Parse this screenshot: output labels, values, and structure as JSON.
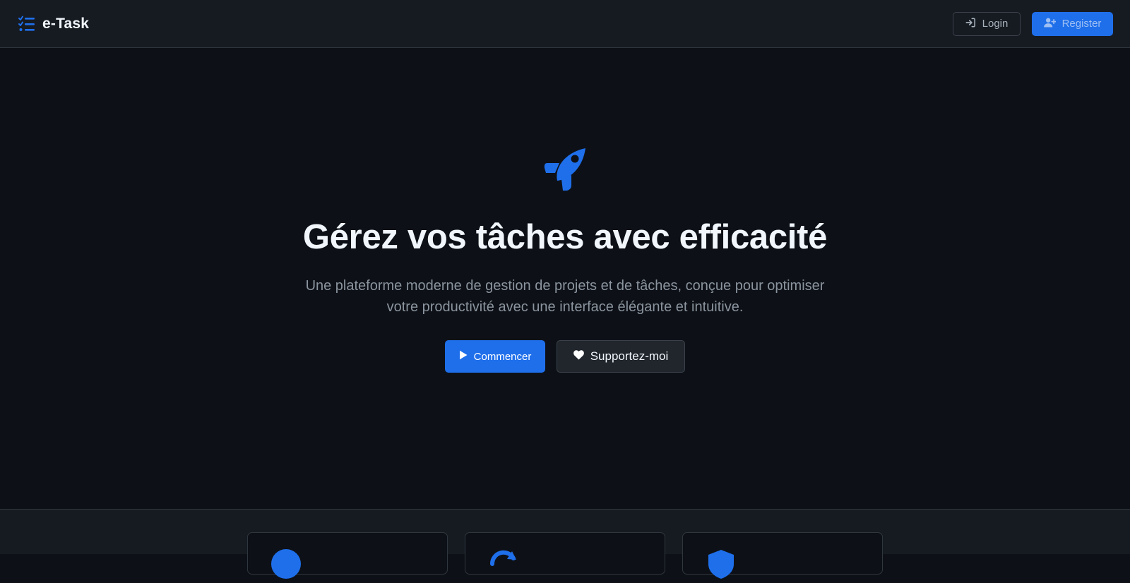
{
  "app": {
    "name": "e-Task",
    "brand_icon": "tasks-list-icon"
  },
  "nav": {
    "login": {
      "label": "Login",
      "icon": "sign-in-icon"
    },
    "register": {
      "label": "Register",
      "icon": "user-plus-icon"
    }
  },
  "hero": {
    "icon": "rocket-icon",
    "title": "Gérez vos tâches avec efficacité",
    "subtitle": "Une plateforme moderne de gestion de projets et de tâches, conçue pour optimiser votre productivité avec une interface élégante et intuitive.",
    "primary_button": {
      "label": "Commencer",
      "icon": "play-icon"
    },
    "secondary_button": {
      "label": "Supportez-moi",
      "icon": "heart-icon"
    }
  },
  "features": {
    "cards": [
      {
        "icon": "circle-icon"
      },
      {
        "icon": "sync-icon"
      },
      {
        "icon": "shield-icon"
      }
    ]
  },
  "colors": {
    "accent": "#1f6feb",
    "background": "#0d1117",
    "surface": "#161b22",
    "border": "#30363d",
    "text": "#f0f6fc",
    "muted": "#8b949e"
  }
}
